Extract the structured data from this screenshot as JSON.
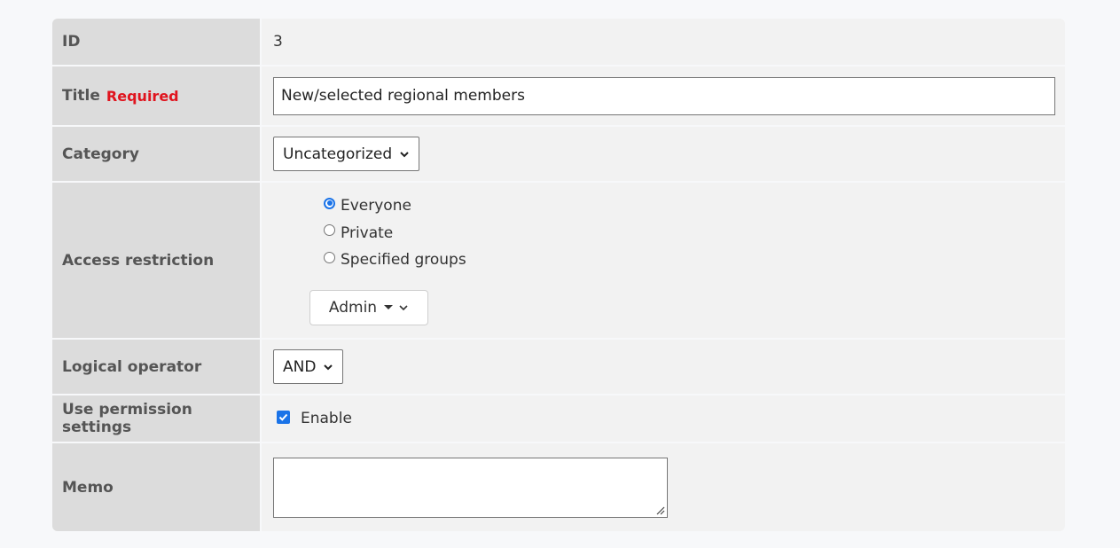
{
  "form": {
    "id": {
      "label": "ID",
      "value": "3"
    },
    "title": {
      "label": "Title",
      "required": "Required",
      "value": "New/selected regional members"
    },
    "category": {
      "label": "Category",
      "selected": "Uncategorized"
    },
    "access": {
      "label": "Access restriction",
      "options": [
        "Everyone",
        "Private",
        "Specified groups"
      ],
      "selected_index": 0,
      "group_button": "Admin"
    },
    "logical_operator": {
      "label": "Logical operator",
      "selected": "AND"
    },
    "permission": {
      "label": "Use permission settings",
      "checkbox_label": "Enable",
      "checked": true
    },
    "memo": {
      "label": "Memo",
      "value": ""
    }
  },
  "colors": {
    "label_bg": "#dcdcdc",
    "value_bg": "#f2f2f2",
    "required": "#e0141e",
    "accent": "#1a73e8"
  },
  "icons": [
    "chevron-down-icon",
    "caret-down-icon",
    "checkmark-icon",
    "resize-grip-icon"
  ]
}
